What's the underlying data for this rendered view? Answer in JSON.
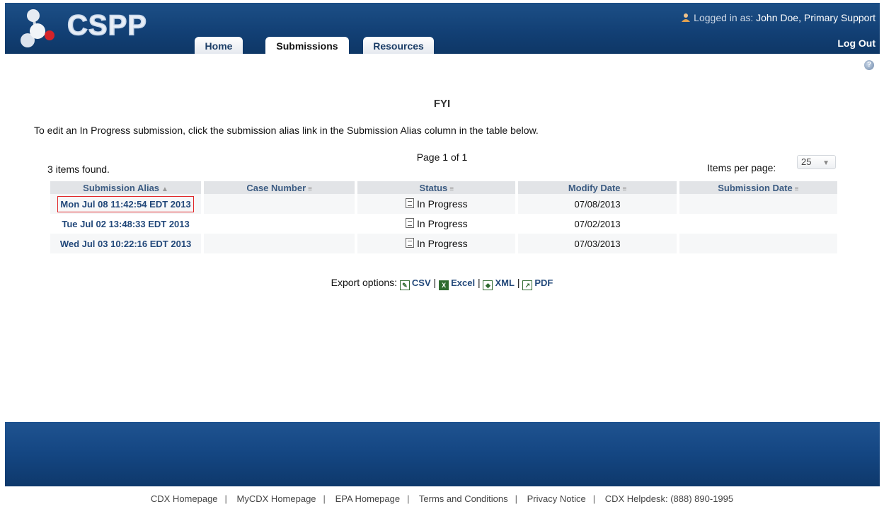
{
  "header": {
    "logo_text": "CSPP",
    "tabs": [
      {
        "label": "Home"
      },
      {
        "label": "Submissions"
      },
      {
        "label": "Resources"
      }
    ],
    "active_tab": "Submissions",
    "login_prefix": "Logged in as:",
    "user_name": "John Doe, Primary Support",
    "logout_label": "Log Out"
  },
  "page": {
    "title": "FYI",
    "instructions": "To edit an In Progress submission, click the submission alias link in the Submission Alias column in the table below.",
    "items_found": "3 items found.",
    "page_info": "Page 1 of 1",
    "items_per_page_label": "Items per page:",
    "items_per_page_value": "25"
  },
  "table": {
    "columns": [
      "Submission Alias",
      "Case Number",
      "Status",
      "Modify Date",
      "Submission Date"
    ],
    "rows": [
      {
        "alias": "Mon Jul 08 11:42:54 EDT 2013",
        "case_number": "",
        "status": "In Progress",
        "modify_date": "07/08/2013",
        "submission_date": ""
      },
      {
        "alias": "Tue Jul 02 13:48:33 EDT 2013",
        "case_number": "",
        "status": "In Progress",
        "modify_date": "07/02/2013",
        "submission_date": ""
      },
      {
        "alias": "Wed Jul 03 10:22:16 EDT 2013",
        "case_number": "",
        "status": "In Progress",
        "modify_date": "07/03/2013",
        "submission_date": ""
      }
    ]
  },
  "export": {
    "label": "Export options:",
    "options": [
      "CSV",
      "Excel",
      "XML",
      "PDF"
    ]
  },
  "footer": {
    "links": [
      "CDX Homepage",
      "MyCDX Homepage",
      "EPA Homepage",
      "Terms and Conditions",
      "Privacy Notice",
      "CDX Helpdesk: (888) 890-1995"
    ]
  },
  "icons": {
    "logo": "molecule-logo-icon",
    "user": "user-icon",
    "help": "help-icon",
    "status": "document-icon",
    "csv": "csv-icon",
    "excel": "excel-icon",
    "xml": "xml-icon",
    "pdf": "pdf-icon"
  }
}
